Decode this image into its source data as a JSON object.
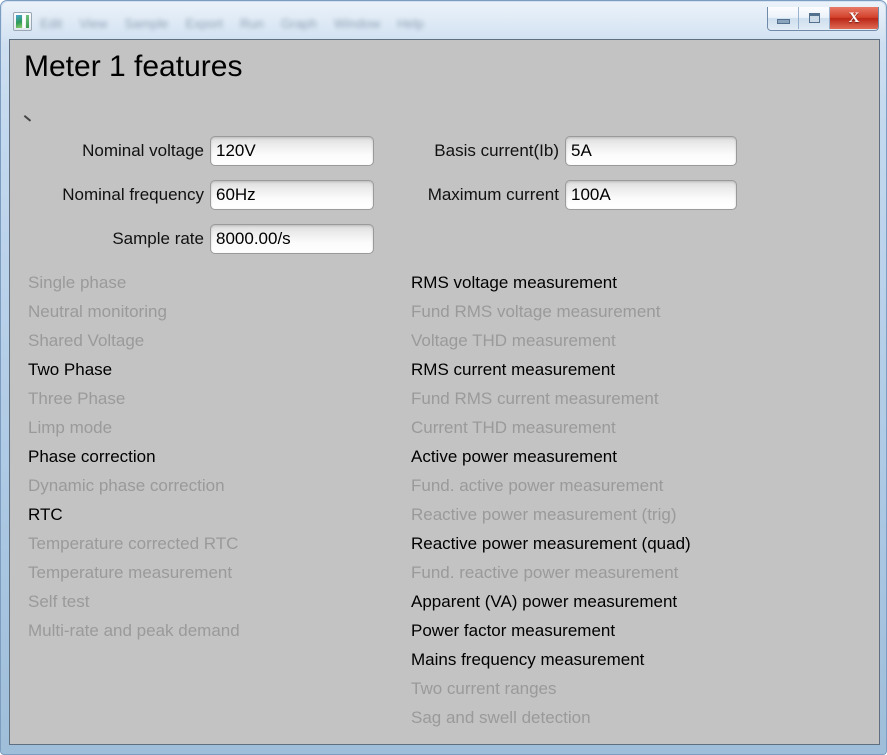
{
  "window": {
    "app_icon": "application-window-icon",
    "menu_items": [
      "Edit",
      "View",
      "Sample",
      "Export",
      "Run",
      "Graph",
      "Window",
      "Help"
    ],
    "controls": {
      "minimize": "minimize-icon",
      "maximize": "maximize-icon",
      "close": "X"
    }
  },
  "page": {
    "title": "Meter 1 features"
  },
  "fields": {
    "nominal_voltage": {
      "label": "Nominal voltage",
      "value": "120V"
    },
    "nominal_frequency": {
      "label": "Nominal frequency",
      "value": "60Hz"
    },
    "sample_rate": {
      "label": "Sample rate",
      "value": "8000.00/s"
    },
    "basis_current": {
      "label": "Basis current(Ib)",
      "value": "5A"
    },
    "maximum_current": {
      "label": "Maximum current",
      "value": "100A"
    }
  },
  "features_left": [
    {
      "label": "Single phase",
      "enabled": false
    },
    {
      "label": "Neutral monitoring",
      "enabled": false
    },
    {
      "label": "Shared Voltage",
      "enabled": false
    },
    {
      "label": "Two Phase",
      "enabled": true
    },
    {
      "label": "Three Phase",
      "enabled": false
    },
    {
      "label": "Limp mode",
      "enabled": false
    },
    {
      "label": "Phase correction",
      "enabled": true
    },
    {
      "label": "Dynamic phase correction",
      "enabled": false
    },
    {
      "label": "RTC",
      "enabled": true
    },
    {
      "label": "Temperature corrected RTC",
      "enabled": false
    },
    {
      "label": "Temperature measurement",
      "enabled": false
    },
    {
      "label": "Self test",
      "enabled": false
    },
    {
      "label": "Multi-rate and peak demand",
      "enabled": false
    }
  ],
  "features_right": [
    {
      "label": "RMS voltage measurement",
      "enabled": true
    },
    {
      "label": "Fund RMS voltage measurement",
      "enabled": false
    },
    {
      "label": "Voltage THD measurement",
      "enabled": false
    },
    {
      "label": "RMS current measurement",
      "enabled": true
    },
    {
      "label": "Fund RMS current measurement",
      "enabled": false
    },
    {
      "label": "Current THD measurement",
      "enabled": false
    },
    {
      "label": "Active power measurement",
      "enabled": true
    },
    {
      "label": "Fund. active power measurement",
      "enabled": false
    },
    {
      "label": "Reactive power measurement (trig)",
      "enabled": false
    },
    {
      "label": "Reactive power measurement (quad)",
      "enabled": true
    },
    {
      "label": "Fund. reactive power measurement",
      "enabled": false
    },
    {
      "label": "Apparent (VA) power measurement",
      "enabled": true
    },
    {
      "label": "Power factor measurement",
      "enabled": true
    },
    {
      "label": "Mains frequency measurement",
      "enabled": true
    },
    {
      "label": "Two current ranges",
      "enabled": false
    },
    {
      "label": "Sag and swell detection",
      "enabled": false
    }
  ],
  "colors": {
    "client_background": "#c3c3c3",
    "enabled_text": "#000000",
    "disabled_text": "#9a9a9a",
    "frame": "#b6cfe8",
    "close_button": "#d2412a"
  }
}
